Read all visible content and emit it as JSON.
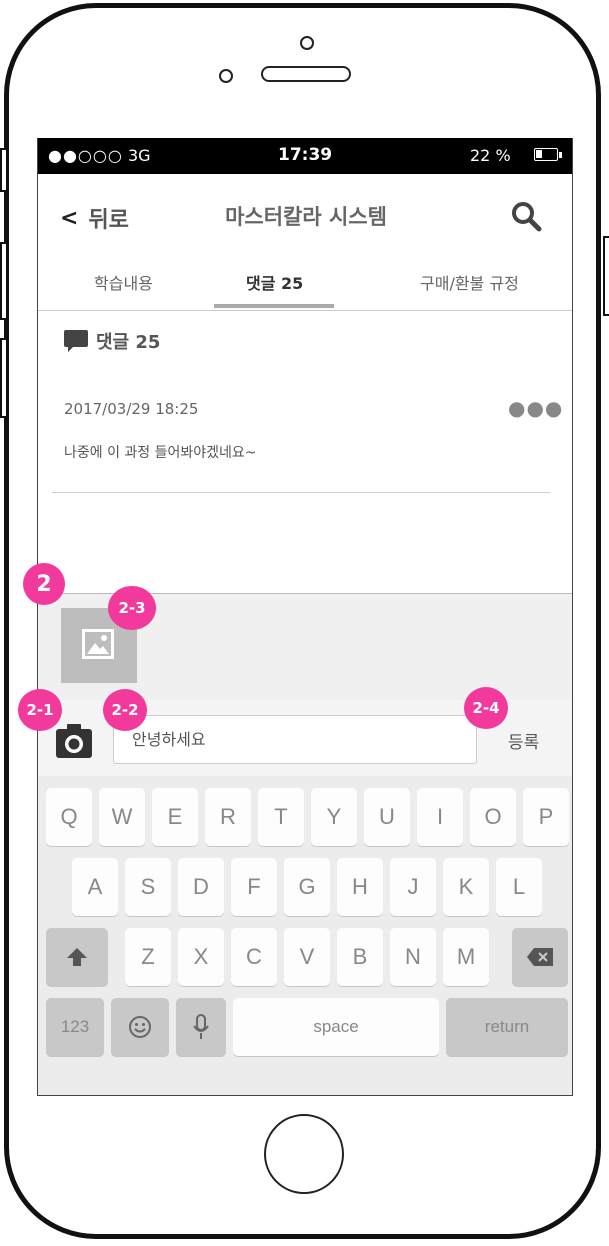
{
  "status_bar": {
    "signal": "●●○○○",
    "network": "3G",
    "time": "17:39",
    "battery_percent": "22 %"
  },
  "nav": {
    "back_label": "뒤로",
    "title": "마스터칼라 시스템"
  },
  "tabs": [
    {
      "label": "학습내용"
    },
    {
      "label": "댓글 25",
      "active": true
    },
    {
      "label": "구매/환불 규정"
    }
  ],
  "comments": {
    "header": "댓글 25",
    "item": {
      "date": "2017/03/29 18:25",
      "text": "나중에 이 과정 들어봐야겠네요~",
      "more": "●●●"
    }
  },
  "composer": {
    "input_value": "안녕하세요",
    "submit_label": "등록"
  },
  "keyboard": {
    "row1": [
      "Q",
      "W",
      "E",
      "R",
      "T",
      "Y",
      "U",
      "I",
      "O",
      "P"
    ],
    "row2": [
      "A",
      "S",
      "D",
      "F",
      "G",
      "H",
      "J",
      "K",
      "L"
    ],
    "row3": [
      "Z",
      "X",
      "C",
      "V",
      "B",
      "N",
      "M"
    ],
    "numbers_label": "123",
    "space_label": "space",
    "return_label": "return"
  },
  "annotations": {
    "m2": "2",
    "m2_1": "2-1",
    "m2_2": "2-2",
    "m2_3": "2-3",
    "m2_4": "2-4"
  },
  "colors": {
    "marker": "#f2399c",
    "status_bar": "#000000"
  },
  "icons": [
    "search-icon",
    "comment-bubble-icon",
    "image-icon",
    "camera-icon",
    "shift-icon",
    "backspace-icon",
    "emoji-icon",
    "microphone-icon"
  ]
}
